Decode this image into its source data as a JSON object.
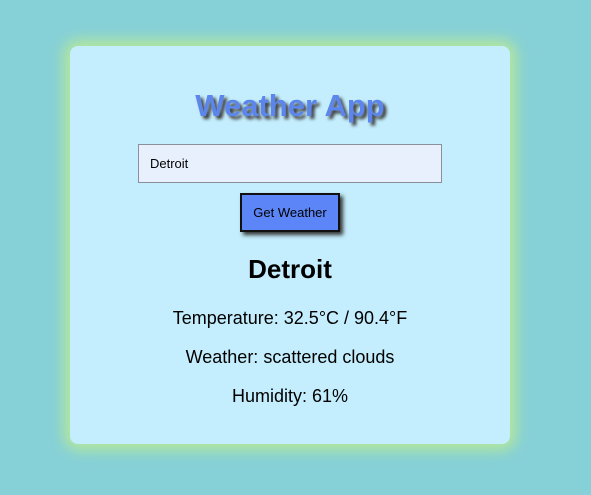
{
  "app": {
    "title": "Weather App"
  },
  "search": {
    "value": "Detroit",
    "button_label": "Get Weather"
  },
  "result": {
    "city": "Detroit",
    "temperature": "Temperature: 32.5°C / 90.4°F",
    "weather": "Weather: scattered clouds",
    "humidity": "Humidity: 61%"
  },
  "colors": {
    "page_background": "#86d0d7",
    "card_background": "#c4eefd",
    "card_glow": "#b6e89a",
    "title": "#5d86ec",
    "button": "#5c86f7",
    "input_background": "#e9f0fd"
  }
}
